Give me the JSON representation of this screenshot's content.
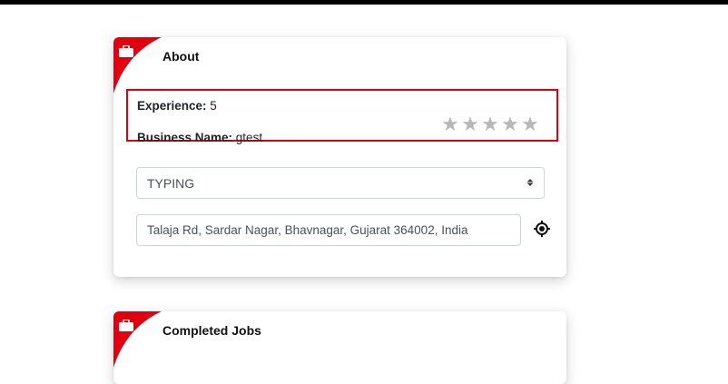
{
  "about": {
    "title": "About",
    "experience_label": "Experience:",
    "experience_value": " 5",
    "business_label": "Business Name:",
    "business_value": " gtest",
    "rating": {
      "filled": 0,
      "max": 5
    },
    "service_select": {
      "value": "TYPING"
    },
    "address_input": {
      "value": "Talaja Rd, Sardar Nagar, Bhavnagar, Gujarat 364002, India"
    }
  },
  "completed_jobs": {
    "title": "Completed Jobs"
  },
  "colors": {
    "accent": "#e0000f",
    "star_empty": "#b8b8b8"
  },
  "icons": {
    "corner": "briefcase-icon",
    "star": "star-icon",
    "select_arrow": "sort-arrows-icon",
    "locate": "crosshair-icon"
  }
}
